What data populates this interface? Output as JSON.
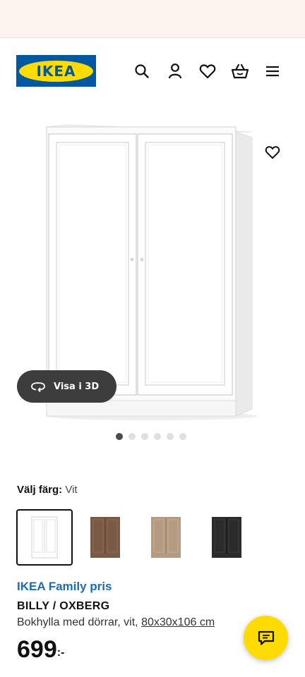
{
  "header": {
    "logo_text": "IKEA",
    "icons": [
      "search-icon",
      "user-icon",
      "heart-icon",
      "basket-icon",
      "menu-icon"
    ]
  },
  "gallery": {
    "view3d_label": "Visa i 3D",
    "image_count": 6,
    "active_index": 0
  },
  "color_picker": {
    "label": "Välj färg:",
    "selected_value": "Vit",
    "options": [
      "white",
      "walnut",
      "oak",
      "black"
    ]
  },
  "product": {
    "family_price_label": "IKEA Family pris",
    "name": "BILLY / OXBERG",
    "desc_prefix": "Bokhylla med dörrar, vit, ",
    "desc_dimensions": "80x30x106 cm",
    "price_main": "699",
    "price_suffix": ":-"
  },
  "colors": {
    "brand_blue": "#0058a3",
    "brand_yellow": "#ffdb00",
    "family_blue": "#1a6bb3"
  }
}
